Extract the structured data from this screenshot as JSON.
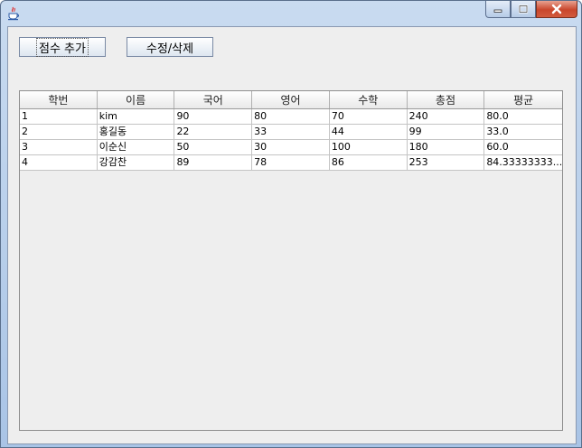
{
  "window": {
    "title": "",
    "app_icon": "java-cup-icon",
    "controls": [
      "minimize-icon",
      "maximize-icon",
      "close-icon"
    ]
  },
  "toolbar": {
    "add_label": "점수 추가",
    "edit_label": "수정/삭제"
  },
  "table": {
    "columns": [
      "학번",
      "이름",
      "국어",
      "영어",
      "수학",
      "총점",
      "평균"
    ],
    "rows": [
      [
        "1",
        "kim",
        "90",
        "80",
        "70",
        "240",
        "80.0"
      ],
      [
        "2",
        "홍길동",
        "22",
        "33",
        "44",
        "99",
        "33.0"
      ],
      [
        "3",
        "이순신",
        "50",
        "30",
        "100",
        "180",
        "60.0"
      ],
      [
        "4",
        "강감찬",
        "89",
        "78",
        "86",
        "253",
        "84.33333333..."
      ]
    ]
  }
}
